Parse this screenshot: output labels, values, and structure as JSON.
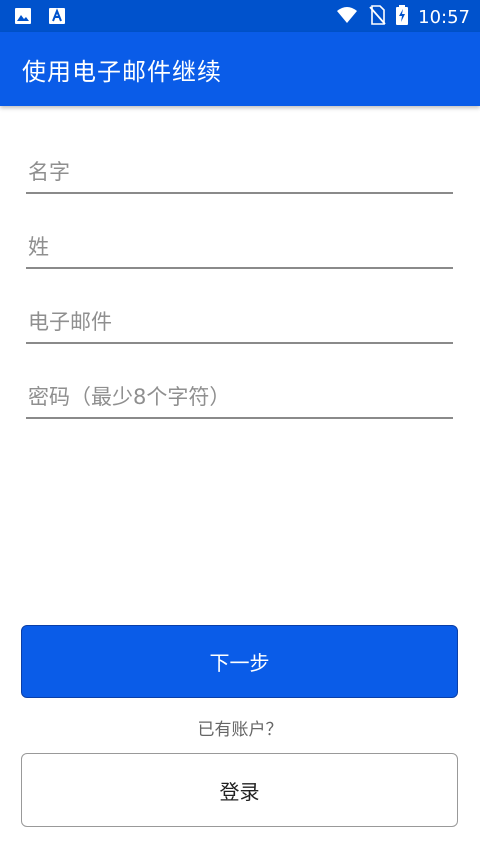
{
  "status_bar": {
    "time": "10:57",
    "left_icons": [
      "gallery-icon",
      "app-notification-icon"
    ],
    "right_icons": [
      "wifi-icon",
      "no-sim-icon",
      "battery-charging-icon"
    ]
  },
  "app_bar": {
    "title": "使用电子邮件继续"
  },
  "form": {
    "first_name": {
      "placeholder": "名字",
      "value": ""
    },
    "last_name": {
      "placeholder": "姓",
      "value": ""
    },
    "email": {
      "placeholder": "电子邮件",
      "value": ""
    },
    "password": {
      "placeholder": "密码（最少8个字符）",
      "value": ""
    }
  },
  "actions": {
    "next_label": "下一步",
    "has_account_text": "已有账户？",
    "login_label": "登录"
  },
  "colors": {
    "status_bar": "#0052cc",
    "primary": "#0a5ce8",
    "field_line": "#8a8a8a"
  }
}
